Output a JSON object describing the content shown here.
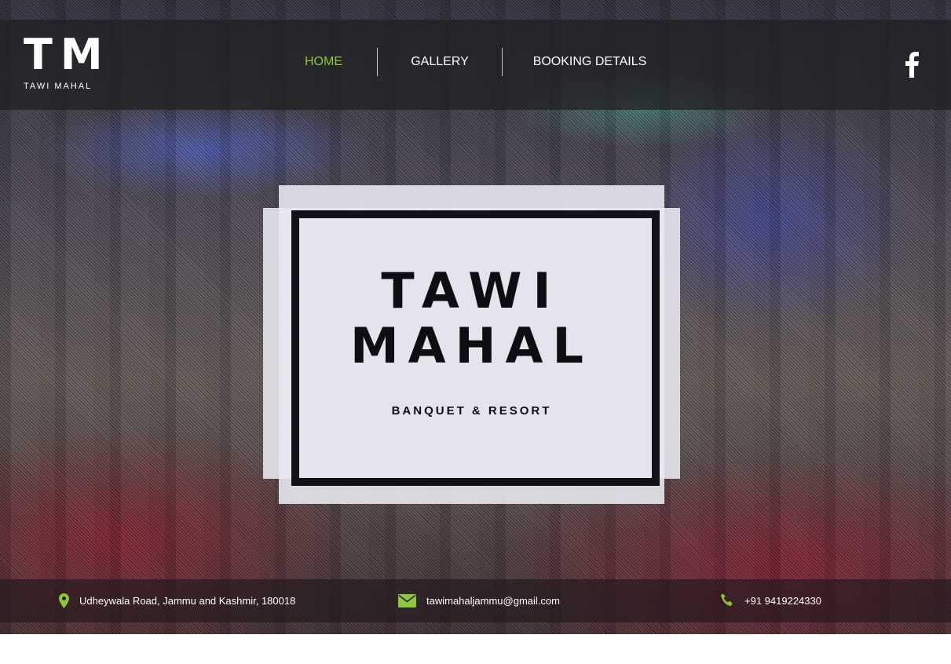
{
  "brand": {
    "logo_mark": "TM",
    "logo_text": "TAWI MAHAL"
  },
  "nav": {
    "items": [
      {
        "label": "HOME",
        "active": true
      },
      {
        "label": "GALLERY",
        "active": false
      },
      {
        "label": "BOOKING DETAILS",
        "active": false
      }
    ]
  },
  "social": {
    "icon": "facebook-icon"
  },
  "hero": {
    "title_line1": "TAWI",
    "title_line2": "MAHAL",
    "subtitle": "BANQUET & RESORT"
  },
  "contact": {
    "address": "Udheywala Road, Jammu and Kashmir, 180018",
    "email": "tawimahaljammu@gmail.com",
    "phone": "+91 9419224330",
    "address_icon": "map-marker-icon",
    "email_icon": "envelope-icon",
    "phone_icon": "phone-icon"
  },
  "colors": {
    "accent": "#8dc63f",
    "card": "#e8e8f0",
    "frame": "#111118"
  }
}
